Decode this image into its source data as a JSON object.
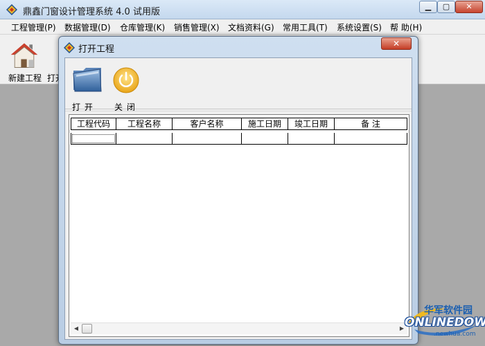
{
  "app": {
    "title": "鼎鑫门窗设计管理系统 4.0 试用版",
    "min_glyph": "▁",
    "max_glyph": "▢",
    "close_glyph": "✕"
  },
  "menu": [
    {
      "label": "工程管理(P)"
    },
    {
      "label": "数据管理(D)"
    },
    {
      "label": "仓库管理(K)"
    },
    {
      "label": "销售管理(X)"
    },
    {
      "label": "文档资料(G)"
    },
    {
      "label": "常用工具(T)"
    },
    {
      "label": "系统设置(S)"
    },
    {
      "label": "帮 助(H)"
    }
  ],
  "toolbar": {
    "new_project_label": "新建工程",
    "open_label_partial": "打开"
  },
  "dialog": {
    "title": "打开工程",
    "close_glyph": "✕",
    "open_label": "打 开",
    "close_label": "关 闭",
    "columns": [
      "工程代码",
      "工程名称",
      "客户名称",
      "施工日期",
      "竣工日期",
      "备  注"
    ],
    "scroll_left": "◀",
    "scroll_right": "▶"
  },
  "watermark": {
    "cn": "华军软件园",
    "en": "ONLINEDOWN",
    "url": ".newhua.com"
  },
  "colors": {
    "titlebar": "#c4d8ee",
    "close_red": "#c43c25",
    "workspace": "#a9a9a9",
    "watermark_blue": "#1b5fb0"
  }
}
